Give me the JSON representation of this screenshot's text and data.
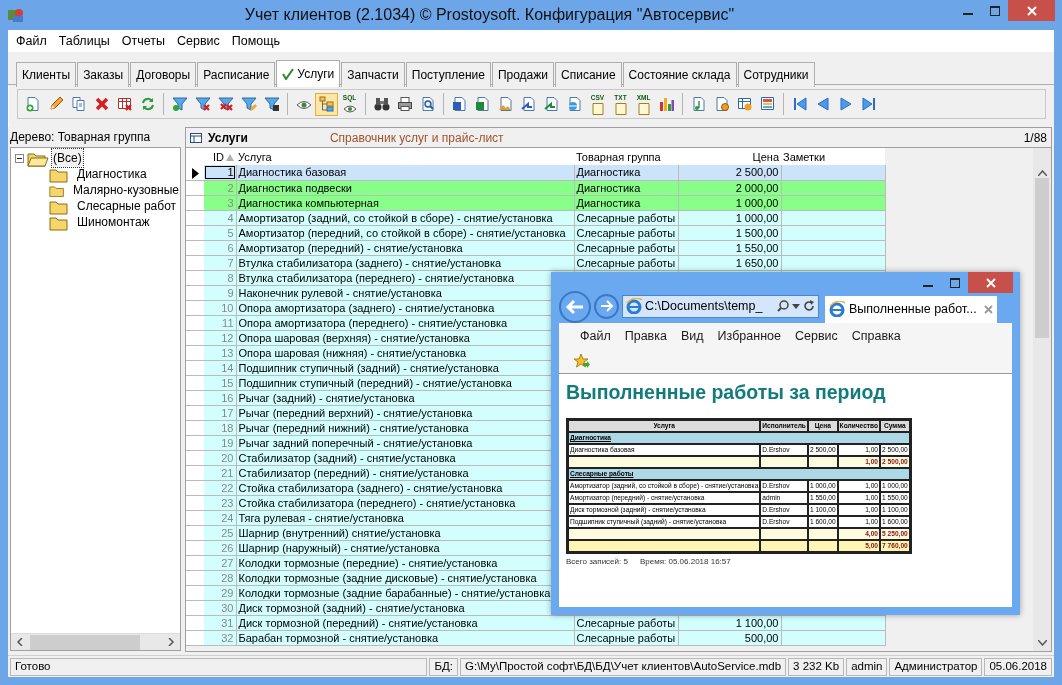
{
  "window": {
    "title": "Учет клиентов (2.1034) © Prostoysoft. Конфигурация \"Автосервис\""
  },
  "menu": [
    "Файл",
    "Таблицы",
    "Отчеты",
    "Сервис",
    "Помощь"
  ],
  "tabs": [
    {
      "label": "Клиенты",
      "selected": false
    },
    {
      "label": "Заказы",
      "selected": false
    },
    {
      "label": "Договоры",
      "selected": false
    },
    {
      "label": "Расписание",
      "selected": false
    },
    {
      "label": "Услуги",
      "selected": true
    },
    {
      "label": "Запчасти",
      "selected": false
    },
    {
      "label": "Поступление",
      "selected": false
    },
    {
      "label": "Продажи",
      "selected": false
    },
    {
      "label": "Списание",
      "selected": false
    },
    {
      "label": "Состояние склада",
      "selected": false
    },
    {
      "label": "Сотрудники",
      "selected": false
    }
  ],
  "toolbar_labels": {
    "sql": "SQL",
    "csv": "CSV",
    "txt": "TXT",
    "xml": "XML"
  },
  "tree": {
    "title": "Дерево: Товарная группа",
    "root": {
      "label": "(Все)",
      "expanded": true,
      "selected": true,
      "children": [
        {
          "label": "Диагностика",
          "selected": false
        },
        {
          "label": "Малярно-кузовные",
          "selected": false
        },
        {
          "label": "Слесарные работ",
          "selected": false
        },
        {
          "label": "Шиномонтаж",
          "selected": false
        }
      ]
    }
  },
  "grid": {
    "title": "Услуги",
    "subtitle": "Справочник услуг и прайс-лист",
    "counter": "1/88",
    "columns": [
      {
        "label": "ID",
        "sorted": true
      },
      {
        "label": "Услуга",
        "sorted": false
      },
      {
        "label": "Товарная группа",
        "sorted": false
      },
      {
        "label": "Цена",
        "sorted": false
      },
      {
        "label": "Заметки",
        "sorted": false
      }
    ],
    "rows": [
      {
        "id": "1",
        "name": "Диагностика базовая",
        "group": "Диагностика",
        "price": "2 500,00",
        "selected": true
      },
      {
        "id": "2",
        "name": "Диагностика подвески",
        "group": "Диагностика",
        "price": "2 000,00",
        "selected": false,
        "color": "#88ff88"
      },
      {
        "id": "3",
        "name": "Диагностика компьютерная",
        "group": "Диагностика",
        "price": "1 000,00",
        "selected": false,
        "color": "#88ff88"
      },
      {
        "id": "4",
        "name": "Амортизатор (задний, со стойкой в сборе) - снятие/установка",
        "group": "Слесарные работы",
        "price": "1 000,00",
        "selected": false,
        "color": "#d2fefe"
      },
      {
        "id": "5",
        "name": "Амортизатор (передний, со стойкой в сборе) - снятие/установка",
        "group": "Слесарные работы",
        "price": "1 500,00",
        "selected": false,
        "color": "#d2fefe"
      },
      {
        "id": "6",
        "name": "Амортизатор (передний) - снятие/установка",
        "group": "Слесарные работы",
        "price": "1 550,00",
        "selected": false,
        "color": "#d2fefe"
      },
      {
        "id": "7",
        "name": "Втулка стабилизатора (заднего) - снятие/установка",
        "group": "Слесарные работы",
        "price": "1 650,00",
        "selected": false,
        "color": "#d2fefe"
      },
      {
        "id": "8",
        "name": "Втулка стабилизатора (переднего) - снятие/установка",
        "selected": false,
        "color": "#d2fefe"
      },
      {
        "id": "9",
        "name": "Наконечник рулевой - снятие/установка",
        "selected": false,
        "color": "#d2fefe"
      },
      {
        "id": "10",
        "name": "Опора амортизатора (заднего) - снятие/установка",
        "selected": false,
        "color": "#d2fefe"
      },
      {
        "id": "11",
        "name": "Опора амортизатора (переднего) - снятие/установка",
        "selected": false,
        "color": "#d2fefe"
      },
      {
        "id": "12",
        "name": "Опора шаровая (верхняя) - снятие/установка",
        "selected": false,
        "color": "#d2fefe"
      },
      {
        "id": "13",
        "name": "Опора шаровая (нижняя) - снятие/установка",
        "selected": false,
        "color": "#d2fefe"
      },
      {
        "id": "14",
        "name": "Подшипник ступичный (задний) - снятие/установка",
        "selected": false,
        "color": "#d2fefe"
      },
      {
        "id": "15",
        "name": "Подшипник ступичный (передний) - снятие/установка",
        "selected": false,
        "color": "#d2fefe"
      },
      {
        "id": "16",
        "name": "Рычаг (задний) - снятие/установка",
        "selected": false,
        "color": "#d2fefe"
      },
      {
        "id": "17",
        "name": "Рычаг (передний верхний) - снятие/установка",
        "selected": false,
        "color": "#d2fefe"
      },
      {
        "id": "18",
        "name": "Рычаг (передний нижний) - снятие/установка",
        "selected": false,
        "color": "#d2fefe"
      },
      {
        "id": "19",
        "name": "Рычаг задний поперечный - снятие/установка",
        "selected": false,
        "color": "#d2fefe"
      },
      {
        "id": "20",
        "name": "Стабилизатор (задний) - снятие/установка",
        "selected": false,
        "color": "#d2fefe"
      },
      {
        "id": "21",
        "name": "Стабилизатор (передний) - снятие/установка",
        "selected": false,
        "color": "#d2fefe"
      },
      {
        "id": "22",
        "name": "Стойка стабилизатора (заднего) - снятие/установка",
        "selected": false,
        "color": "#d2fefe"
      },
      {
        "id": "23",
        "name": "Стойка стабилизатора (переднего) - снятие/установка",
        "selected": false,
        "color": "#d2fefe"
      },
      {
        "id": "24",
        "name": "Тяга рулевая - снятие/установка",
        "selected": false,
        "color": "#d2fefe"
      },
      {
        "id": "25",
        "name": "Шарнир (внутренний) снятие/установка",
        "selected": false,
        "color": "#d2fefe"
      },
      {
        "id": "26",
        "name": "Шарнир (наружный) - снятие/установка",
        "selected": false,
        "color": "#d2fefe"
      },
      {
        "id": "27",
        "name": "Колодки тормозные (передние) - снятие/установка",
        "selected": false,
        "color": "#d2fefe"
      },
      {
        "id": "28",
        "name": "Колодки тормозные (задние дисковые) - снятие/установка",
        "selected": false,
        "color": "#d2fefe"
      },
      {
        "id": "29",
        "name": "Колодки тормозные (задние барабанные) - снятие/установка",
        "selected": false,
        "color": "#d2fefe"
      },
      {
        "id": "30",
        "name": "Диск тормозной (задний) - снятие/установка",
        "selected": false,
        "color": "#d2fefe"
      },
      {
        "id": "31",
        "name": "Диск тормозной (передний) - снятие/установка",
        "group": "Слесарные работы",
        "price": "1 100,00",
        "selected": false,
        "color": "#d2fefe"
      },
      {
        "id": "32",
        "name": "Барабан тормозной - снятие/установка",
        "group": "Слесарные работы",
        "price": "500,00",
        "selected": false,
        "color": "#d2fefe"
      }
    ]
  },
  "status_bar": {
    "message": "Готово",
    "db_label": "БД:",
    "db_path": "G:\\My\\Простой софт\\БД\\БД\\Учет клиентов\\AutoService.mdb",
    "db_size": "3 232 Kb",
    "user": "admin",
    "role": "Администратор",
    "date": "05.06.2018"
  },
  "browser": {
    "address": "C:\\Documents\\temp_",
    "tab_title": "Выполненные работ...",
    "menu": [
      "Файл",
      "Правка",
      "Вид",
      "Избранное",
      "Сервис",
      "Справка"
    ],
    "report": {
      "title": "Выполненные работы за период",
      "columns": [
        "Услуга",
        "Исполнитель",
        "Цена",
        "Количество",
        "Сумма"
      ],
      "rows": [
        {
          "kind": "group",
          "label": "Диагностика"
        },
        {
          "kind": "item",
          "cells": [
            "Диагностика базовая",
            "D.Ershov",
            "2 500,00",
            "1,00",
            "2 500,00"
          ]
        },
        {
          "kind": "subtotal",
          "qty": "1,00",
          "sum": "2 500,00"
        },
        {
          "kind": "group",
          "label": "Слесарные работы"
        },
        {
          "kind": "item",
          "cells": [
            "Амортизатор (задний, со стойкой в сборе) - снятие/установка",
            "D.Ershov",
            "1 000,00",
            "1,00",
            "1 000,00"
          ]
        },
        {
          "kind": "item",
          "cells": [
            "Амортизатор (передний) - снятие/установка",
            "admin",
            "1 550,00",
            "1,00",
            "1 550,00"
          ]
        },
        {
          "kind": "item",
          "cells": [
            "Диск тормозной (задний) - снятие/установка",
            "D.Ershov",
            "1 100,00",
            "1,00",
            "1 100,00"
          ]
        },
        {
          "kind": "item",
          "cells": [
            "Подшипник ступичный (задний) - снятие/установка",
            "D.Ershov",
            "1 600,00",
            "1,00",
            "1 600,00"
          ]
        },
        {
          "kind": "subtotal",
          "qty": "4,00",
          "sum": "5 250,00"
        },
        {
          "kind": "total",
          "qty": "5,00",
          "sum": "7 760,00"
        }
      ],
      "records": "Всего записей: 5",
      "time": "Время: 05.06.2018 16:57"
    }
  }
}
